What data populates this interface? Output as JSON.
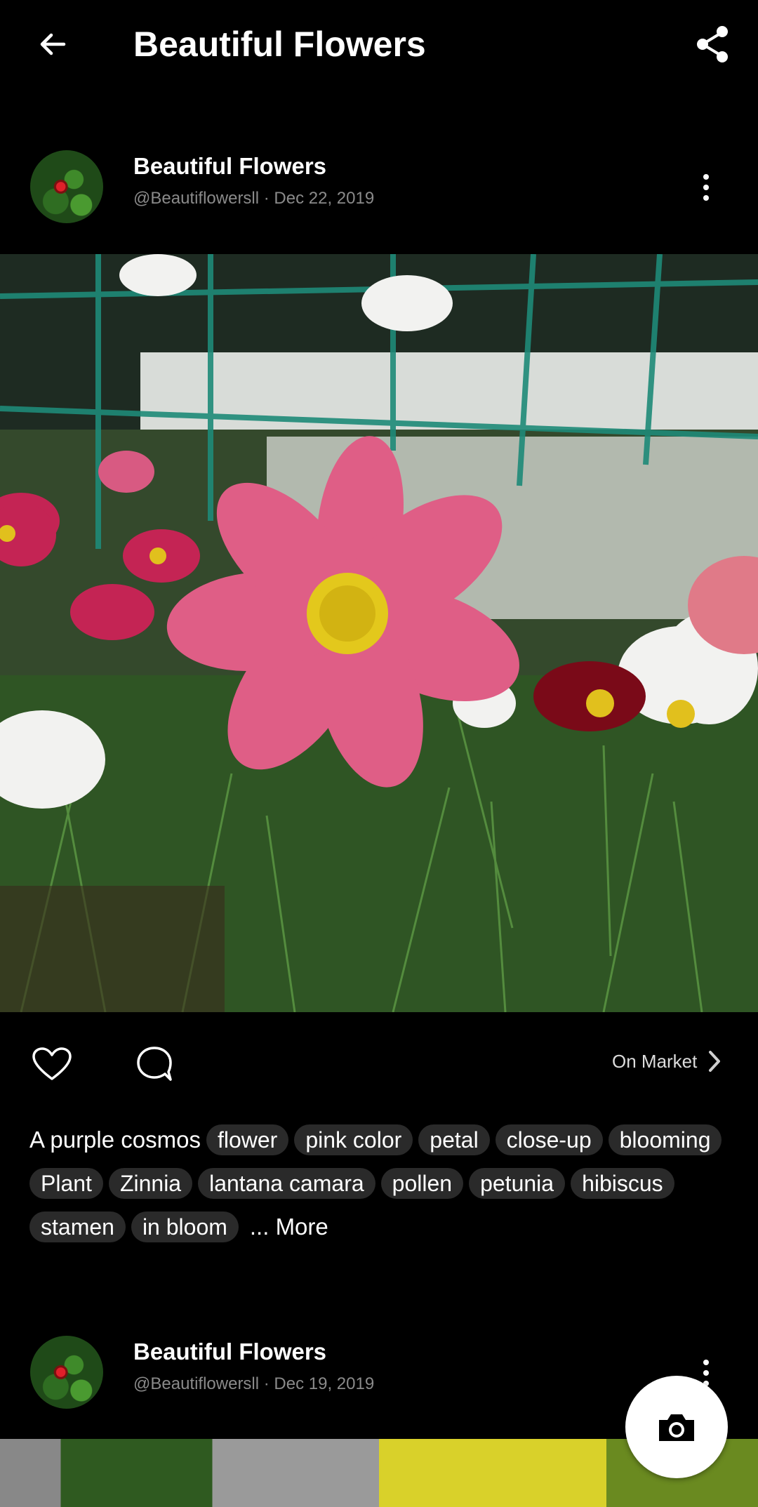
{
  "app_bar": {
    "title": "Beautiful Flowers",
    "back_icon": "arrow-left-icon",
    "share_icon": "share-icon"
  },
  "posts": [
    {
      "author": "Beautiful Flowers",
      "handle_date": "@Beautiflowersll · Dec 22, 2019",
      "caption": "A purple cosmos",
      "tags": [
        "flower",
        "pink color",
        "petal",
        "close-up",
        "blooming",
        "Plant",
        "Zinnia",
        "lantana camara",
        "pollen",
        "petunia",
        "hibiscus",
        "stamen",
        "in bloom"
      ],
      "more_label": "... More",
      "market_label": "On Market"
    },
    {
      "author": "Beautiful Flowers",
      "handle_date": "@Beautiflowersll · Dec 19, 2019"
    }
  ],
  "colors": {
    "background": "#000000",
    "tag_bg": "#2a2a2a",
    "meta_text": "#8a8a8a",
    "fab_bg": "#ffffff"
  }
}
